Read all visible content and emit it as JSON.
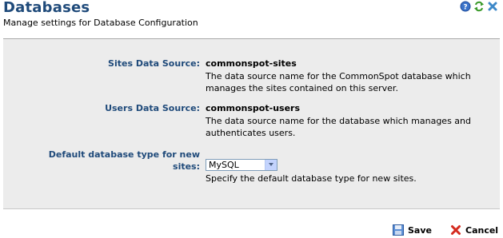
{
  "header": {
    "title": "Databases",
    "subtitle": "Manage settings for Database Configuration",
    "icons": [
      "help-icon",
      "refresh-icon",
      "close-icon"
    ]
  },
  "form": {
    "sites": {
      "label": "Sites Data Source:",
      "value": "commonspot-sites",
      "description_lines": [
        "The data source name for the CommonSpot database which",
        "manages the sites contained on this server."
      ]
    },
    "users": {
      "label": "Users Data Source:",
      "value": "commonspot-users",
      "description_lines": [
        "The data source name for the database which manages and",
        "authenticates users."
      ]
    },
    "dbtype": {
      "label_lines": [
        "Default database type for new",
        "sites:"
      ],
      "selected": "MySQL",
      "description": "Specify the default database type for new sites."
    }
  },
  "footer": {
    "save_label": "Save",
    "cancel_label": "Cancel"
  },
  "colors": {
    "title": "#1f4a7a",
    "label": "#1f4a7a",
    "panel": "#ececec"
  }
}
